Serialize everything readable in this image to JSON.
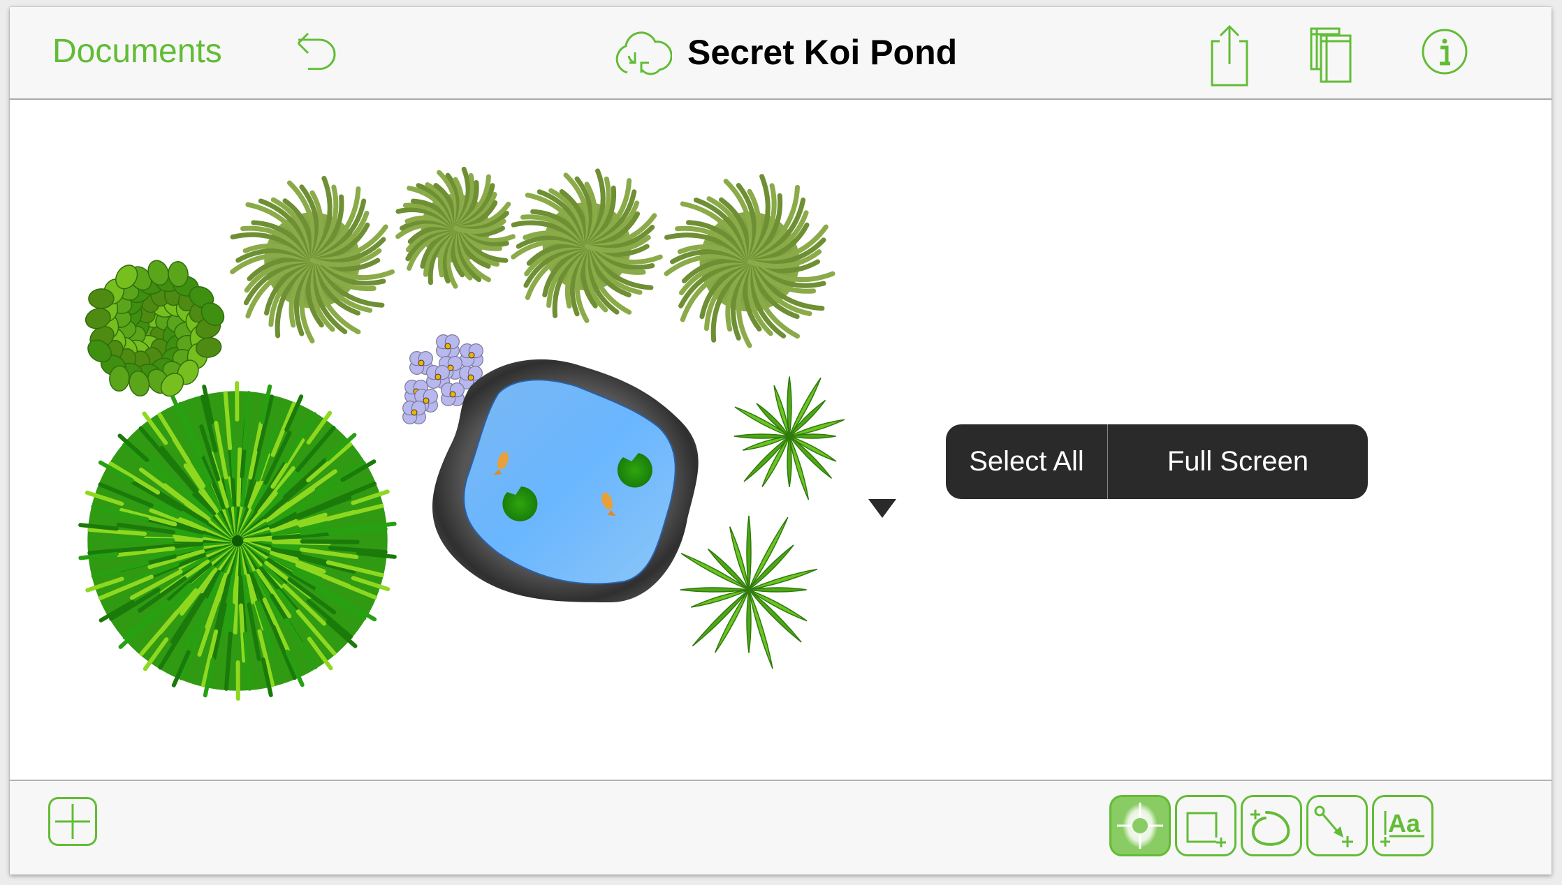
{
  "navbar": {
    "back_label": "Documents",
    "title": "Secret Koi Pond",
    "icons": {
      "undo": "undo-arrow-icon",
      "sync": "cloud-sync-icon",
      "share": "share-icon",
      "canvases": "canvases-icon",
      "info": "info-icon"
    }
  },
  "context_menu": {
    "items": [
      {
        "label": "Select All"
      },
      {
        "label": "Full Screen"
      }
    ]
  },
  "canvas": {
    "title": "Secret Koi Pond",
    "objects": [
      "leafy-shrub",
      "ornamental-grass-1",
      "ornamental-grass-2",
      "ornamental-grass-3",
      "ornamental-grass-4",
      "round-spiky-bush",
      "flower-cluster",
      "koi-pond",
      "spiky-plant-1",
      "spiky-plant-2"
    ]
  },
  "toolbar": {
    "add_button": "add-icon",
    "tools": [
      {
        "name": "selection-tool",
        "active": true
      },
      {
        "name": "shape-tool",
        "active": false
      },
      {
        "name": "freehand-tool",
        "active": false
      },
      {
        "name": "line-tool",
        "active": false
      },
      {
        "name": "text-tool",
        "active": false,
        "glyph": "Aa"
      }
    ]
  },
  "colors": {
    "accent": "#62bc35",
    "active_tool_fill": "#88cc63",
    "popup_bg": "#2a2a2a",
    "navbar_bg": "#f7f7f7"
  }
}
